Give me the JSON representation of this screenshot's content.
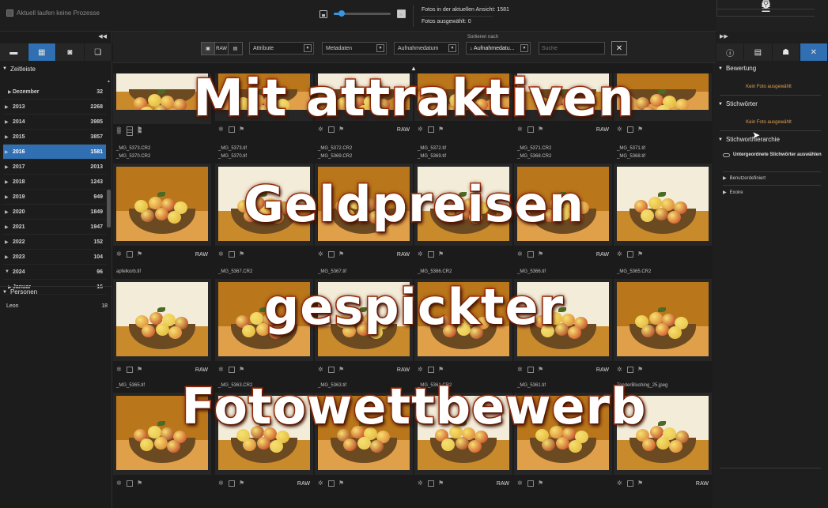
{
  "topbar": {
    "process_status": "Aktuell laufen keine Prozesse",
    "photos_in_view": "Fotos in der aktuellen Ansicht: 1581",
    "photos_selected": "Fotos ausgewählt: 0",
    "zoom_level_fraction": 0.12
  },
  "left_panel": {
    "timeline_header": "Zeitleiste",
    "years": [
      {
        "label": "Dezember",
        "count": "32",
        "sub": true
      },
      {
        "label": "2013",
        "count": "2268"
      },
      {
        "label": "2014",
        "count": "3985"
      },
      {
        "label": "2015",
        "count": "3857"
      },
      {
        "label": "2016",
        "count": "1581",
        "selected": true
      },
      {
        "label": "2017",
        "count": "2013"
      },
      {
        "label": "2018",
        "count": "1243"
      },
      {
        "label": "2019",
        "count": "949"
      },
      {
        "label": "2020",
        "count": "1849"
      },
      {
        "label": "2021",
        "count": "1947"
      },
      {
        "label": "2022",
        "count": "152"
      },
      {
        "label": "2023",
        "count": "104"
      },
      {
        "label": "2024",
        "count": "96",
        "expanded": true
      },
      {
        "label": "Januar",
        "count": "16",
        "sub": true
      }
    ],
    "people_header": "Personen",
    "people": [
      {
        "name": "Leon",
        "count": "18"
      }
    ]
  },
  "toolbar": {
    "raw_label": "RAW",
    "attribute": "Attribute",
    "metadata": "Metadaten",
    "date_field": "Aufnahmedatum",
    "sort_label": "Sortieren nach",
    "sort_value": "↓ Aufnahmedatu...",
    "search_placeholder": "Suche"
  },
  "grid": {
    "rows": [
      [
        {
          "name": "",
          "raw": false
        },
        {
          "name": "_MG_5373.CR2",
          "raw": false
        },
        {
          "name": "_MG_5373.tif",
          "raw": false
        },
        {
          "name": "_MG_5372.CR2",
          "raw": true
        },
        {
          "name": "_MG_5372.tif",
          "raw": false
        },
        {
          "name": "_MG_5371.CR2",
          "raw": true
        },
        {
          "name": "_MG_5371.tif",
          "raw": false
        }
      ],
      [
        {
          "name": "_MG_5370.CR2",
          "raw": true
        },
        {
          "name": "_MG_5370.tif",
          "raw": false
        },
        {
          "name": "_MG_5369.CR2",
          "raw": true
        },
        {
          "name": "_MG_5369.tif",
          "raw": false
        },
        {
          "name": "_MG_5368.CR2",
          "raw": true
        },
        {
          "name": "_MG_5368.tif",
          "raw": false
        }
      ],
      [
        {
          "name": "apfelkorb.tif",
          "raw": true
        },
        {
          "name": "_MG_5367.CR2",
          "raw": false
        },
        {
          "name": "_MG_5367.tif",
          "raw": true
        },
        {
          "name": "_MG_5366.CR2",
          "raw": false
        },
        {
          "name": "_MG_5366.tif",
          "raw": true
        },
        {
          "name": "_MG_5365.CR2",
          "raw": false
        }
      ],
      [
        {
          "name": "_MG_5365.tif",
          "raw": false
        },
        {
          "name": "_MG_5363.CR2",
          "raw": true
        },
        {
          "name": "_MG_5363.tif",
          "raw": false
        },
        {
          "name": "_MG_5361.CR2",
          "raw": true
        },
        {
          "name": "_MG_5361.tif",
          "raw": false
        },
        {
          "name": "TenderBlushing_25.jpeg",
          "raw": true
        }
      ]
    ],
    "raw_badge": "RAW"
  },
  "right_panel": {
    "rating_header": "Bewertung",
    "no_photo_1": "Kein Foto ausgewählt",
    "keywords_header": "Stichwörter",
    "no_photo_2": "Kein Foto ausgewählt",
    "hierarchy_header": "Stichworthierarchie",
    "subordinate_toggle": "Untergeordnete Stichwörter auswählen",
    "custom": "Benutzerdefiniert",
    "exoire": "Exoire"
  },
  "overlay": {
    "line1": "Mit attraktiven",
    "line2": "Geldpreisen",
    "line3": "gespickter",
    "line4": "Fotowettbewerb"
  },
  "colors": {
    "accent": "#2f6fb2",
    "warning_text": "#e0a050",
    "overlay_stroke": "#c23a12"
  }
}
